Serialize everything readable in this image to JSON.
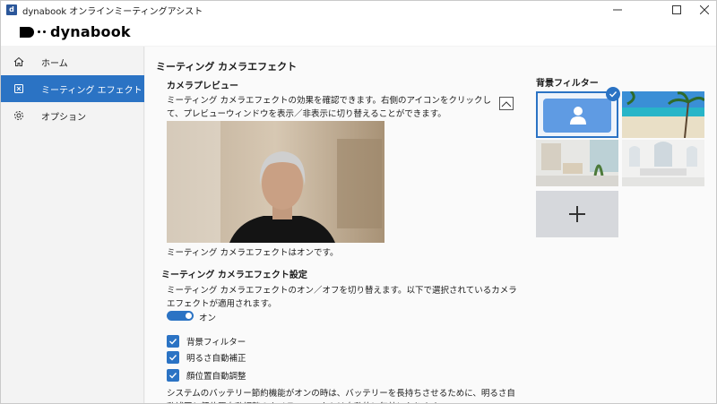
{
  "window": {
    "title": "dynabook オンラインミーティングアシスト",
    "app_icon_glyph": "d",
    "minimize_icon": "minimize-icon",
    "maximize_icon": "maximize-icon",
    "close_icon": "close-icon"
  },
  "logo": {
    "text": "dynabook"
  },
  "sidebar": {
    "items": [
      {
        "label": "ホーム",
        "icon": "home-icon"
      },
      {
        "label": "ミーティング エフェクト",
        "icon": "camera-effect-icon",
        "selected": true
      },
      {
        "label": "オプション",
        "icon": "gear-icon"
      }
    ]
  },
  "main": {
    "title": "ミーティング カメラエフェクト",
    "preview_section": {
      "title": "カメラプレビュー",
      "description": "ミーティング カメラエフェクトの効果を確認できます。右側のアイコンをクリックして、プレビューウィンドウを表示／非表示に切り替えることができます。",
      "status": "ミーティング カメラエフェクトはオンです。"
    },
    "settings_section": {
      "title": "ミーティング カメラエフェクト設定",
      "description": "ミーティング カメラエフェクトのオン／オフを切り替えます。以下で選択されているカメラエフェクトが適用されます。",
      "toggle_label": "オン",
      "toggle_on": true,
      "checkboxes": [
        {
          "label": "背景フィルター",
          "checked": true
        },
        {
          "label": "明るさ自動補正",
          "checked": true
        },
        {
          "label": "顔位置自動調整",
          "checked": true
        }
      ],
      "note": "システムのバッテリー節約機能がオンの時は、バッテリーを長持ちさせるために、明るさ自動補正と顔位置自動調整のカメラエフェクトは自動的に無効になります。"
    },
    "background_filter": {
      "title": "背景フィルター",
      "thumbnails": [
        {
          "name": "person-silhouette",
          "selected": true
        },
        {
          "name": "beach"
        },
        {
          "name": "living-room"
        },
        {
          "name": "white-interior"
        }
      ],
      "add_label": "+"
    }
  },
  "colors": {
    "accent": "#2b73c4",
    "sidebar_bg": "#f3f3f3",
    "main_bg": "#fafafa"
  }
}
